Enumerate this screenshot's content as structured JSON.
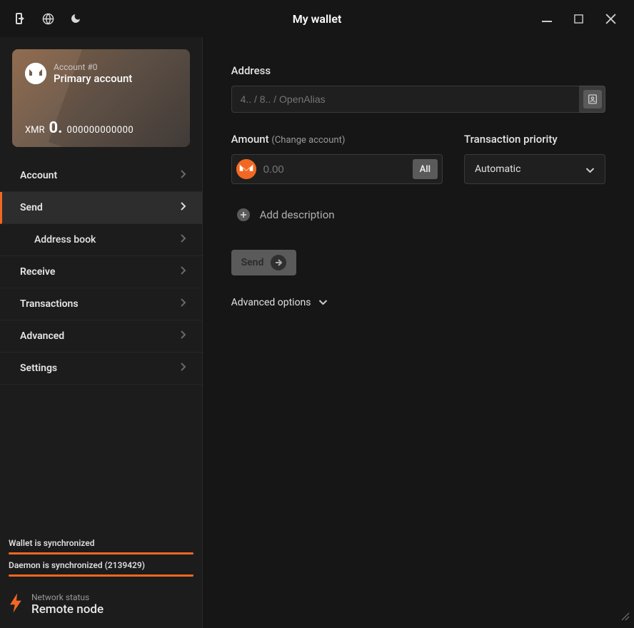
{
  "titlebar": {
    "title": "My wallet"
  },
  "account_card": {
    "sub": "Account #0",
    "name": "Primary account",
    "currency": "XMR",
    "balance_int": "0.",
    "balance_dec": "000000000000"
  },
  "nav": {
    "account": "Account",
    "send": "Send",
    "address_book": "Address book",
    "receive": "Receive",
    "transactions": "Transactions",
    "advanced": "Advanced",
    "settings": "Settings"
  },
  "sync": {
    "wallet": "Wallet is synchronized",
    "daemon": "Daemon is synchronized (2139429)",
    "network_sub": "Network status",
    "network_main": "Remote node"
  },
  "main": {
    "address_label": "Address",
    "address_placeholder": "4.. / 8.. / OpenAlias",
    "amount_label": "Amount",
    "amount_hint": "(Change account)",
    "amount_placeholder": "0.00",
    "all_label": "All",
    "priority_label": "Transaction priority",
    "priority_value": "Automatic",
    "add_description": "Add description",
    "send_label": "Send",
    "advanced_options": "Advanced options"
  }
}
